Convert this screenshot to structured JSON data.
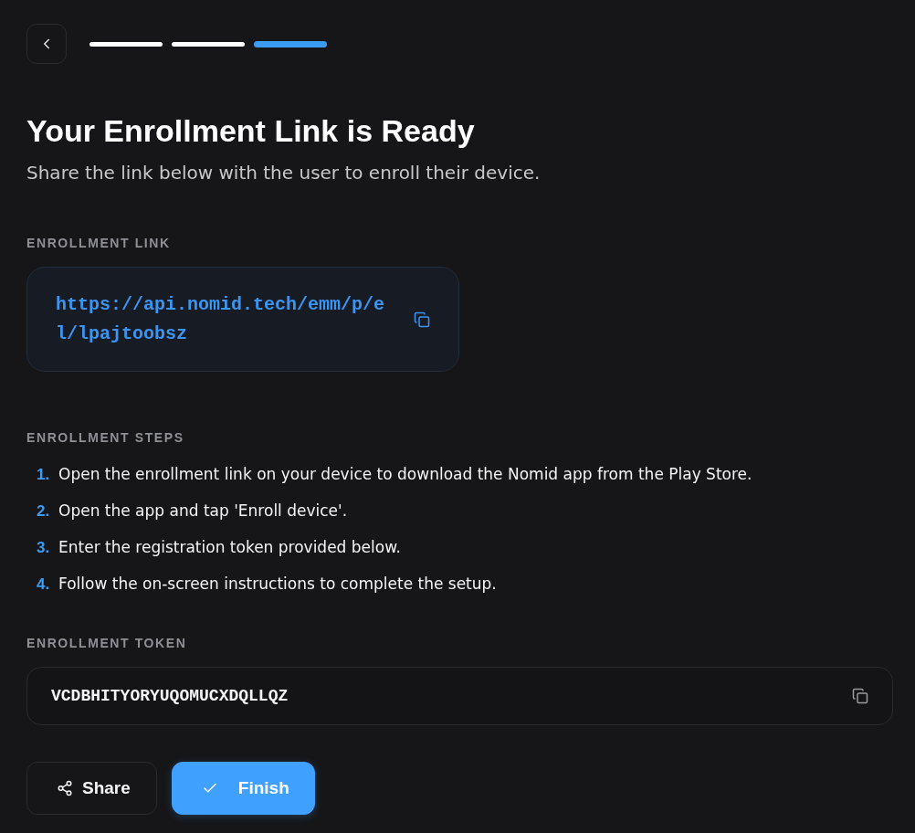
{
  "progress_steps": [
    {
      "selected": false
    },
    {
      "selected": false
    },
    {
      "selected": true
    }
  ],
  "title": "Your Enrollment Link is Ready",
  "subtitle": "Share the link below with the user to enroll their device.",
  "link_section": {
    "label": "ENROLLMENT LINK",
    "url": "https://api.nomid.tech/emm/p/el/lpajtoobsz"
  },
  "steps_section": {
    "label": "ENROLLMENT STEPS",
    "steps": [
      {
        "number": "1.",
        "text": "Open the enrollment link on your device to download the Nomid app from the Play Store."
      },
      {
        "number": "2.",
        "text": "Open the app and tap 'Enroll device'."
      },
      {
        "number": "3.",
        "text": "Enter the registration token provided below."
      },
      {
        "number": "4.",
        "text": "Follow the on-screen instructions to complete the setup."
      }
    ]
  },
  "token_section": {
    "label": "ENROLLMENT TOKEN",
    "token": "VCDBHITYORYUQOMUCXDQLLQZ"
  },
  "buttons": [
    {
      "kind": "secondary",
      "label": "Share"
    },
    {
      "kind": "primary",
      "label": "Finish"
    }
  ]
}
